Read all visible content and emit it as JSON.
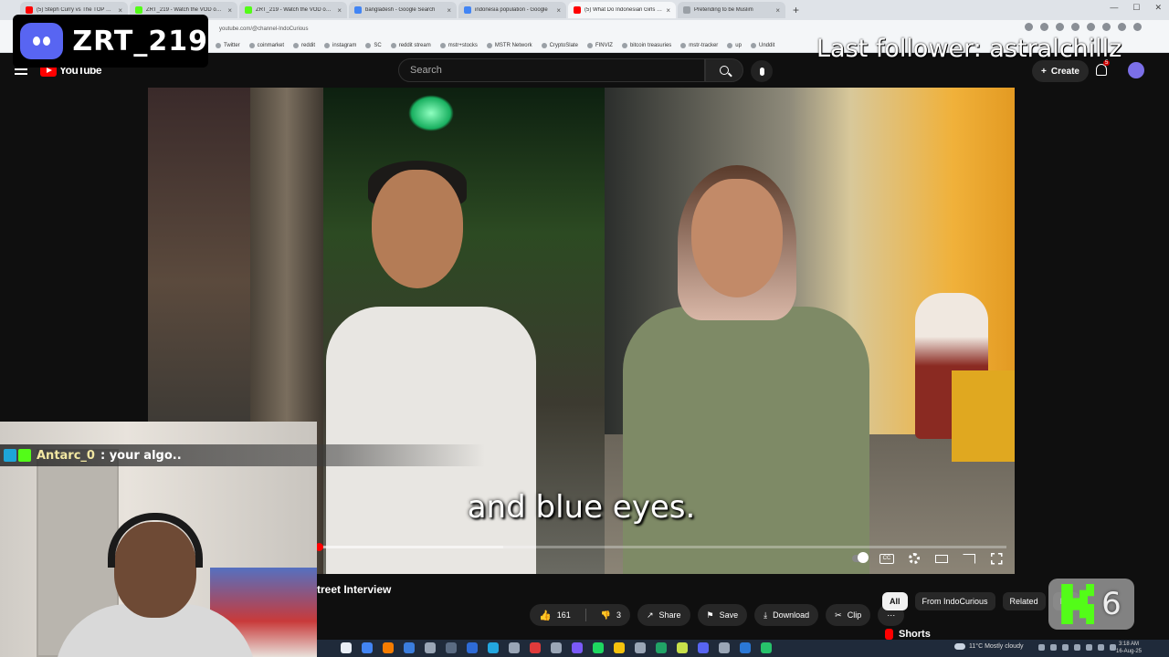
{
  "browser": {
    "tabs": [
      {
        "title": "(5) Steph Curry vs The TOP High",
        "fav_color": "#ff0000",
        "active": false
      },
      {
        "title": "ZRT_219 - Watch the VOD on K",
        "fav_color": "#53fc18",
        "active": false
      },
      {
        "title": "ZRT_219 - Watch the VOD on K",
        "fav_color": "#53fc18",
        "active": false
      },
      {
        "title": "bangladesh - Google Search",
        "fav_color": "#4285f4",
        "active": false
      },
      {
        "title": "indonesia population - Google",
        "fav_color": "#4285f4",
        "active": false
      },
      {
        "title": "(5) What Do Indonesian Girls Th",
        "fav_color": "#ff0000",
        "active": true
      },
      {
        "title": "Pretending to be Muslim",
        "fav_color": "#9aa0a6",
        "active": false
      }
    ],
    "url": "youtube.com/@channel-IndoCurious",
    "bookmarks": [
      "Twitter",
      "coinmarket",
      "reddit",
      "instagram",
      "SC",
      "reddit stream",
      "mstr+stocks",
      "MSTR Network",
      "CryptoSlate",
      "FINVIZ",
      "bitcoin treasuries",
      "mstr-tracker",
      "up",
      "Unddit"
    ]
  },
  "overlay": {
    "streamer_name": "ZRT_219",
    "last_follower": "Last follower: astralchillz",
    "chat": {
      "user": "Antarc_0",
      "message": ": your algo.."
    },
    "kick_count": "6"
  },
  "youtube": {
    "logo_text": "YouTube",
    "search_placeholder": "Search",
    "create_label": "Create",
    "notification_count": "5",
    "subtitle": "and blue eyes.",
    "progress": {
      "played_pct": 0.3,
      "buffered_pct": 27
    },
    "video_title": "treet Interview",
    "actions": {
      "likes": "161",
      "dislikes": "3",
      "share": "Share",
      "save": "Save",
      "download": "Download",
      "clip": "Clip",
      "more": "⋯"
    },
    "chips": [
      "All",
      "From IndoCurious",
      "Related",
      "For"
    ],
    "shorts_label": "Shorts"
  },
  "taskbar": {
    "weather": "11°C  Mostly cloudy",
    "time": "3:18 AM",
    "date": "16-Aug-25"
  }
}
